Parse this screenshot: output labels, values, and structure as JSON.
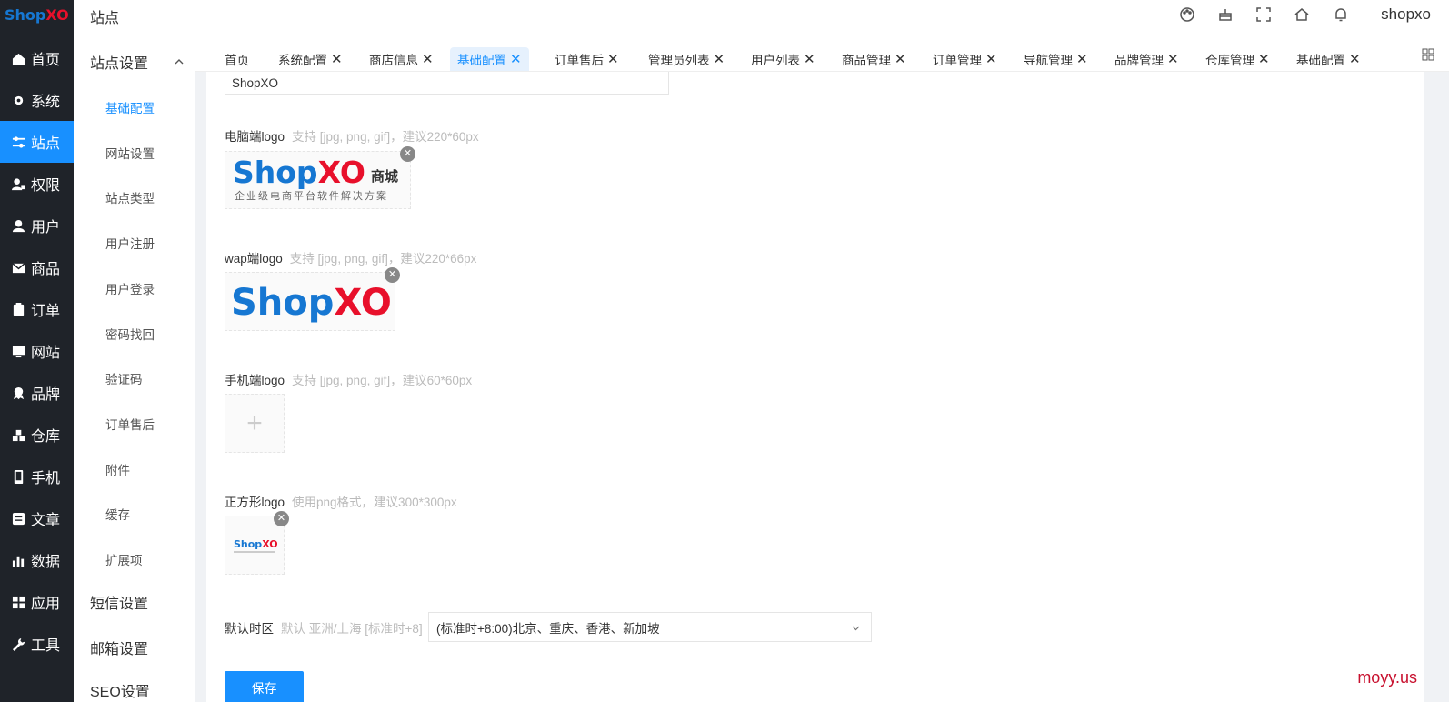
{
  "logo": {
    "part1": "Shop",
    "part2": "XO"
  },
  "main_nav": [
    {
      "label": "首页",
      "icon": "home-icon"
    },
    {
      "label": "系统",
      "icon": "gear-icon"
    },
    {
      "label": "站点",
      "icon": "sliders-icon",
      "active": true
    },
    {
      "label": "权限",
      "icon": "user-lock-icon"
    },
    {
      "label": "用户",
      "icon": "user-icon"
    },
    {
      "label": "商品",
      "icon": "mail-icon"
    },
    {
      "label": "订单",
      "icon": "clipboard-icon"
    },
    {
      "label": "网站",
      "icon": "monitor-icon"
    },
    {
      "label": "品牌",
      "icon": "award-icon"
    },
    {
      "label": "仓库",
      "icon": "boxes-icon"
    },
    {
      "label": "手机",
      "icon": "phone-icon"
    },
    {
      "label": "文章",
      "icon": "article-icon"
    },
    {
      "label": "数据",
      "icon": "bar-chart-icon"
    },
    {
      "label": "应用",
      "icon": "apps-icon"
    },
    {
      "label": "工具",
      "icon": "wrench-icon"
    }
  ],
  "sub_nav": {
    "title": "站点",
    "group_site": "站点设置",
    "items": [
      "基础配置",
      "网站设置",
      "站点类型",
      "用户注册",
      "用户登录",
      "密码找回",
      "验证码",
      "订单售后",
      "附件",
      "缓存",
      "扩展项"
    ],
    "active_item": "基础配置",
    "group_sms": "短信设置",
    "group_email": "邮箱设置",
    "group_seo": "SEO设置"
  },
  "header": {
    "user": "shopxo"
  },
  "tabs": [
    {
      "label": "首页",
      "closable": false
    },
    {
      "label": "系统配置",
      "closable": true
    },
    {
      "label": "商店信息",
      "closable": true
    },
    {
      "label": "基础配置",
      "closable": true,
      "active": true
    },
    {
      "label": "订单售后",
      "closable": true
    },
    {
      "label": "管理员列表",
      "closable": true
    },
    {
      "label": "用户列表",
      "closable": true
    },
    {
      "label": "商品管理",
      "closable": true
    },
    {
      "label": "订单管理",
      "closable": true
    },
    {
      "label": "导航管理",
      "closable": true
    },
    {
      "label": "品牌管理",
      "closable": true
    },
    {
      "label": "仓库管理",
      "closable": true
    },
    {
      "label": "基础配置",
      "closable": true
    }
  ],
  "form": {
    "site_name_value": "ShopXO",
    "pc_logo": {
      "label": "电脑端logo",
      "tip": "支持 [jpg, png, gif]，建议220*60px"
    },
    "wap_logo": {
      "label": "wap端logo",
      "tip": "支持 [jpg, png, gif]，建议220*66px"
    },
    "mobile_logo": {
      "label": "手机端logo",
      "tip": "支持 [jpg, png, gif]，建议60*60px"
    },
    "square_logo": {
      "label": "正方形logo",
      "tip": "使用png格式，建议300*300px"
    },
    "timezone": {
      "label": "默认时区",
      "tip": "默认 亚洲/上海 [标准时+8]",
      "value": "(标准时+8:00)北京、重庆、香港、新加坡"
    },
    "save_label": "保存"
  },
  "logo_images": {
    "pc_main_a": "Shop",
    "pc_main_b": "XO",
    "pc_suffix": "商城",
    "pc_slogan": "企业级电商平台软件解决方案",
    "wap_a": "Shop",
    "wap_b": "XO",
    "square_a": "Shop",
    "square_b": "XO"
  },
  "watermark": "moyy.us",
  "colors": {
    "brand_blue": "#1890ff",
    "sidebar_dark": "#1f2329",
    "logo_blue": "#1677d2",
    "logo_red": "#e8102b"
  }
}
